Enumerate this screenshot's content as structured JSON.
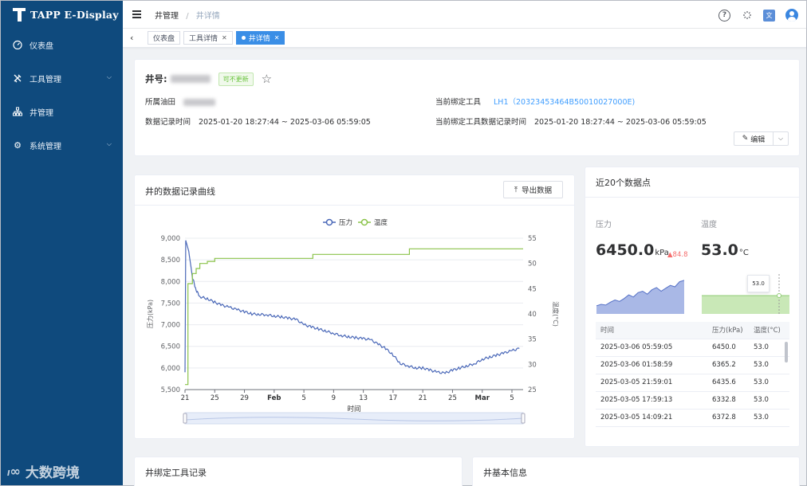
{
  "app": {
    "name": "TAPP E-Display"
  },
  "sidebar": {
    "items": [
      {
        "label": "仪表盘",
        "icon": "dashboard-icon",
        "expandable": false
      },
      {
        "label": "工具管理",
        "icon": "tools-icon",
        "expandable": true
      },
      {
        "label": "井管理",
        "icon": "hierarchy-icon",
        "expandable": false
      },
      {
        "label": "系统管理",
        "icon": "gear-icon",
        "expandable": true
      }
    ]
  },
  "watermark": {
    "text": "大数跨境"
  },
  "header": {
    "breadcrumb": [
      "井管理",
      "井详情"
    ]
  },
  "tags": [
    {
      "label": "仪表盘",
      "closable": false,
      "active": false
    },
    {
      "label": "工具详情",
      "closable": true,
      "active": false
    },
    {
      "label": "井详情",
      "closable": true,
      "active": true
    }
  ],
  "well": {
    "title_label": "井号:",
    "status_badge": "可不更新",
    "field_label": "所属油田",
    "record_time_label": "数据记录时间",
    "record_time_value": "2025-01-20 18:27:44 ~ 2025-03-06 05:59:05",
    "tool_label": "当前绑定工具",
    "tool_value": "LH1（20323453464B50010027000E)",
    "tool_time_label": "当前绑定工具数据记录时间",
    "tool_time_value": "2025-01-20 18:27:44 ~ 2025-03-06 05:59:05",
    "edit_label": "编辑"
  },
  "chart_panel": {
    "title": "井的数据记录曲线",
    "export_label": "导出数据"
  },
  "chart_data": {
    "type": "line",
    "xlabel": "时间",
    "x_ticks": [
      "21",
      "25",
      "29",
      "Feb",
      "5",
      "9",
      "13",
      "17",
      "21",
      "25",
      "Mar",
      "5"
    ],
    "y_left": {
      "label": "压力(kPa)",
      "ticks": [
        "9,000",
        "8,500",
        "8,000",
        "7,500",
        "7,000",
        "6,500",
        "6,000",
        "5,500"
      ],
      "range": [
        5500,
        9000
      ]
    },
    "y_right": {
      "label": "温度(°C)",
      "ticks": [
        "55",
        "50",
        "45",
        "40",
        "35",
        "30",
        "25"
      ],
      "range": [
        25,
        55
      ]
    },
    "x_range_days": [
      0,
      45.5
    ],
    "series": [
      {
        "name": "压力",
        "axis": "left",
        "color": "#4a68b8",
        "points": [
          [
            0,
            5900
          ],
          [
            0.1,
            8950
          ],
          [
            0.5,
            8700
          ],
          [
            1,
            8100
          ],
          [
            1.5,
            7800
          ],
          [
            2,
            7650
          ],
          [
            3,
            7600
          ],
          [
            4,
            7520
          ],
          [
            5,
            7450
          ],
          [
            6,
            7400
          ],
          [
            7,
            7350
          ],
          [
            8,
            7300
          ],
          [
            9,
            7250
          ],
          [
            10,
            7240
          ],
          [
            11,
            7230
          ],
          [
            12,
            7200
          ],
          [
            13,
            7180
          ],
          [
            14,
            7150
          ],
          [
            15,
            7120
          ],
          [
            16,
            7000
          ],
          [
            17,
            6950
          ],
          [
            18,
            6900
          ],
          [
            19,
            6850
          ],
          [
            20,
            6800
          ],
          [
            21,
            6750
          ],
          [
            22,
            6720
          ],
          [
            23,
            6700
          ],
          [
            24,
            6680
          ],
          [
            25,
            6650
          ],
          [
            26,
            6550
          ],
          [
            27,
            6450
          ],
          [
            28,
            6300
          ],
          [
            29,
            6100
          ],
          [
            30,
            6050
          ],
          [
            31,
            6000
          ],
          [
            32,
            6000
          ],
          [
            33,
            5950
          ],
          [
            34,
            5900
          ],
          [
            35,
            5880
          ],
          [
            36,
            5950
          ],
          [
            37,
            6000
          ],
          [
            38,
            6050
          ],
          [
            39,
            6100
          ],
          [
            40,
            6200
          ],
          [
            41,
            6250
          ],
          [
            42,
            6300
          ],
          [
            43,
            6350
          ],
          [
            44,
            6400
          ],
          [
            45,
            6450
          ]
        ]
      },
      {
        "name": "温度",
        "axis": "right",
        "color": "#8bc34a",
        "points": [
          [
            0,
            26
          ],
          [
            0.4,
            46
          ],
          [
            1,
            48
          ],
          [
            1.5,
            49
          ],
          [
            2,
            50
          ],
          [
            3,
            50.4
          ],
          [
            4,
            51
          ],
          [
            10,
            51
          ],
          [
            17,
            51
          ],
          [
            17.2,
            51.8
          ],
          [
            30,
            51.8
          ],
          [
            30.2,
            52.9
          ],
          [
            45.5,
            52.9
          ]
        ]
      }
    ]
  },
  "recent": {
    "title": "近20个数据点",
    "pressure_label": "压力",
    "pressure_value": "6450.0",
    "pressure_unit": "kPa",
    "pressure_delta": "84.8",
    "temp_label": "温度",
    "temp_value": "53.0",
    "temp_unit": "°C",
    "temp_tooltip": "53.0",
    "table_headers": [
      "时间",
      "压力(kPa)",
      "温度(°C)"
    ],
    "rows": [
      [
        "2025-03-06 05:59:05",
        "6450.0",
        "53.0"
      ],
      [
        "2025-03-06 01:58:59",
        "6365.2",
        "53.0"
      ],
      [
        "2025-03-05 21:59:01",
        "6435.6",
        "53.0"
      ],
      [
        "2025-03-05 17:59:13",
        "6332.8",
        "53.0"
      ],
      [
        "2025-03-05 14:09:21",
        "6372.8",
        "53.0"
      ]
    ],
    "spark_pressure": [
      6100,
      6120,
      6110,
      6150,
      6180,
      6160,
      6200,
      6250,
      6220,
      6280,
      6300,
      6260,
      6320,
      6350,
      6300,
      6340,
      6380,
      6360,
      6430,
      6450
    ],
    "spark_temp": [
      53,
      53,
      53,
      53,
      53,
      53,
      53,
      53,
      53,
      53,
      53,
      53,
      53,
      53,
      53,
      53,
      53,
      53,
      53,
      53
    ]
  },
  "bottom": {
    "tool_records_title": "井绑定工具记录",
    "basic_info_title": "井基本信息"
  },
  "colors": {
    "sidebar": "#0f4a7d",
    "accent": "#409eff",
    "pressure": "#4a68b8",
    "temperature": "#8bc34a"
  }
}
